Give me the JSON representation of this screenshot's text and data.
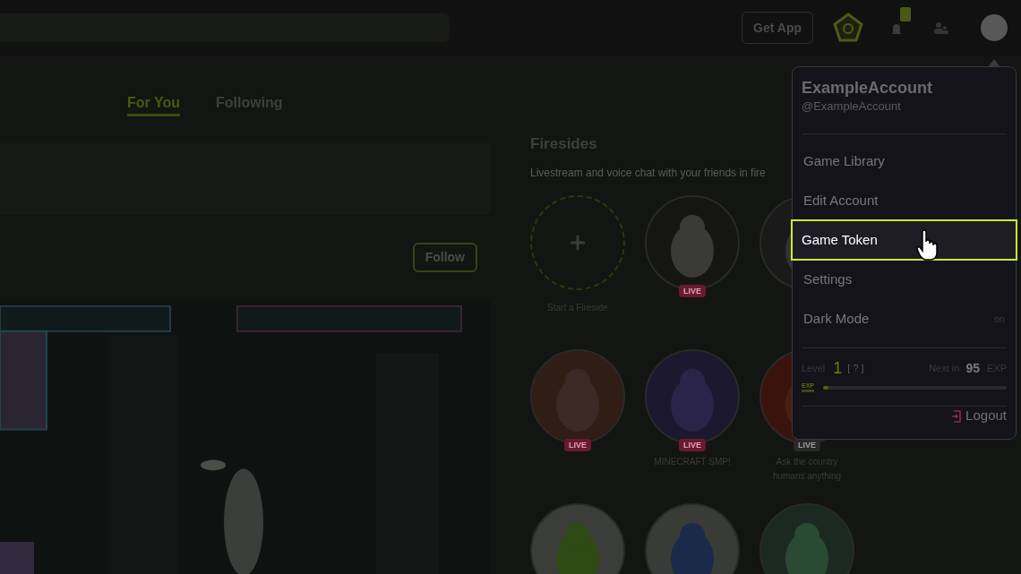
{
  "top_bar": {
    "get_app": "Get App"
  },
  "feed_tabs": [
    {
      "label": "For You",
      "selected": true
    },
    {
      "label": "Following",
      "selected": false
    }
  ],
  "post": {
    "follow": "Follow"
  },
  "firesides": {
    "title": "Firesides",
    "subtitle": "Livestream and voice chat with your friends in fire",
    "items": [
      {
        "kind": "start",
        "label": "Start a Fireside"
      },
      {
        "kind": "room",
        "badge": "LIVE",
        "live": true
      },
      {
        "kind": "room"
      },
      {
        "kind": "room",
        "badge": "LIVE",
        "live": true
      },
      {
        "kind": "room",
        "badge": "LIVE",
        "live": true,
        "label": "MINECRAFT SMP!"
      },
      {
        "kind": "room",
        "badge": "LIVE",
        "live": false,
        "label": "Ask the country humans anything"
      },
      {
        "kind": "room"
      },
      {
        "kind": "room"
      },
      {
        "kind": "room"
      }
    ]
  },
  "account_menu": {
    "name": "ExampleAccount",
    "handle": "@ExampleAccount",
    "items": [
      {
        "label": "Game Library",
        "selected": false
      },
      {
        "label": "Edit Account",
        "selected": false
      },
      {
        "label": "Game Token",
        "selected": true
      },
      {
        "label": "Settings",
        "selected": false
      },
      {
        "label": "Dark Mode",
        "selected": false,
        "value": "on"
      }
    ],
    "progress": {
      "label": "Level",
      "value": "1",
      "help": "[ ? ]",
      "next_label": "Next in",
      "next_value": "95",
      "unit": "EXP",
      "badge": "EXP",
      "level": 0.03
    },
    "logout": "Logout"
  }
}
